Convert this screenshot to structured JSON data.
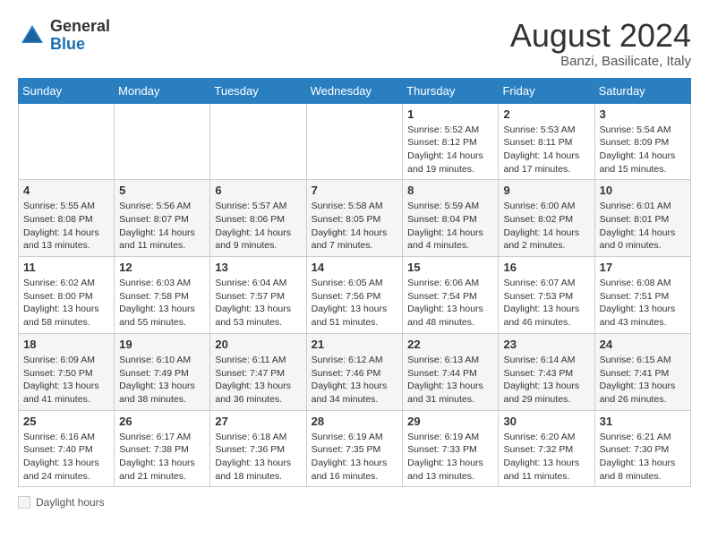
{
  "header": {
    "logo_general": "General",
    "logo_blue": "Blue",
    "month_year": "August 2024",
    "location": "Banzi, Basilicate, Italy"
  },
  "weekdays": [
    "Sunday",
    "Monday",
    "Tuesday",
    "Wednesday",
    "Thursday",
    "Friday",
    "Saturday"
  ],
  "weeks": [
    [
      {
        "day": "",
        "info": ""
      },
      {
        "day": "",
        "info": ""
      },
      {
        "day": "",
        "info": ""
      },
      {
        "day": "",
        "info": ""
      },
      {
        "day": "1",
        "info": "Sunrise: 5:52 AM\nSunset: 8:12 PM\nDaylight: 14 hours and 19 minutes."
      },
      {
        "day": "2",
        "info": "Sunrise: 5:53 AM\nSunset: 8:11 PM\nDaylight: 14 hours and 17 minutes."
      },
      {
        "day": "3",
        "info": "Sunrise: 5:54 AM\nSunset: 8:09 PM\nDaylight: 14 hours and 15 minutes."
      }
    ],
    [
      {
        "day": "4",
        "info": "Sunrise: 5:55 AM\nSunset: 8:08 PM\nDaylight: 14 hours and 13 minutes."
      },
      {
        "day": "5",
        "info": "Sunrise: 5:56 AM\nSunset: 8:07 PM\nDaylight: 14 hours and 11 minutes."
      },
      {
        "day": "6",
        "info": "Sunrise: 5:57 AM\nSunset: 8:06 PM\nDaylight: 14 hours and 9 minutes."
      },
      {
        "day": "7",
        "info": "Sunrise: 5:58 AM\nSunset: 8:05 PM\nDaylight: 14 hours and 7 minutes."
      },
      {
        "day": "8",
        "info": "Sunrise: 5:59 AM\nSunset: 8:04 PM\nDaylight: 14 hours and 4 minutes."
      },
      {
        "day": "9",
        "info": "Sunrise: 6:00 AM\nSunset: 8:02 PM\nDaylight: 14 hours and 2 minutes."
      },
      {
        "day": "10",
        "info": "Sunrise: 6:01 AM\nSunset: 8:01 PM\nDaylight: 14 hours and 0 minutes."
      }
    ],
    [
      {
        "day": "11",
        "info": "Sunrise: 6:02 AM\nSunset: 8:00 PM\nDaylight: 13 hours and 58 minutes."
      },
      {
        "day": "12",
        "info": "Sunrise: 6:03 AM\nSunset: 7:58 PM\nDaylight: 13 hours and 55 minutes."
      },
      {
        "day": "13",
        "info": "Sunrise: 6:04 AM\nSunset: 7:57 PM\nDaylight: 13 hours and 53 minutes."
      },
      {
        "day": "14",
        "info": "Sunrise: 6:05 AM\nSunset: 7:56 PM\nDaylight: 13 hours and 51 minutes."
      },
      {
        "day": "15",
        "info": "Sunrise: 6:06 AM\nSunset: 7:54 PM\nDaylight: 13 hours and 48 minutes."
      },
      {
        "day": "16",
        "info": "Sunrise: 6:07 AM\nSunset: 7:53 PM\nDaylight: 13 hours and 46 minutes."
      },
      {
        "day": "17",
        "info": "Sunrise: 6:08 AM\nSunset: 7:51 PM\nDaylight: 13 hours and 43 minutes."
      }
    ],
    [
      {
        "day": "18",
        "info": "Sunrise: 6:09 AM\nSunset: 7:50 PM\nDaylight: 13 hours and 41 minutes."
      },
      {
        "day": "19",
        "info": "Sunrise: 6:10 AM\nSunset: 7:49 PM\nDaylight: 13 hours and 38 minutes."
      },
      {
        "day": "20",
        "info": "Sunrise: 6:11 AM\nSunset: 7:47 PM\nDaylight: 13 hours and 36 minutes."
      },
      {
        "day": "21",
        "info": "Sunrise: 6:12 AM\nSunset: 7:46 PM\nDaylight: 13 hours and 34 minutes."
      },
      {
        "day": "22",
        "info": "Sunrise: 6:13 AM\nSunset: 7:44 PM\nDaylight: 13 hours and 31 minutes."
      },
      {
        "day": "23",
        "info": "Sunrise: 6:14 AM\nSunset: 7:43 PM\nDaylight: 13 hours and 29 minutes."
      },
      {
        "day": "24",
        "info": "Sunrise: 6:15 AM\nSunset: 7:41 PM\nDaylight: 13 hours and 26 minutes."
      }
    ],
    [
      {
        "day": "25",
        "info": "Sunrise: 6:16 AM\nSunset: 7:40 PM\nDaylight: 13 hours and 24 minutes."
      },
      {
        "day": "26",
        "info": "Sunrise: 6:17 AM\nSunset: 7:38 PM\nDaylight: 13 hours and 21 minutes."
      },
      {
        "day": "27",
        "info": "Sunrise: 6:18 AM\nSunset: 7:36 PM\nDaylight: 13 hours and 18 minutes."
      },
      {
        "day": "28",
        "info": "Sunrise: 6:19 AM\nSunset: 7:35 PM\nDaylight: 13 hours and 16 minutes."
      },
      {
        "day": "29",
        "info": "Sunrise: 6:19 AM\nSunset: 7:33 PM\nDaylight: 13 hours and 13 minutes."
      },
      {
        "day": "30",
        "info": "Sunrise: 6:20 AM\nSunset: 7:32 PM\nDaylight: 13 hours and 11 minutes."
      },
      {
        "day": "31",
        "info": "Sunrise: 6:21 AM\nSunset: 7:30 PM\nDaylight: 13 hours and 8 minutes."
      }
    ]
  ],
  "footer": {
    "daylight_label": "Daylight hours"
  }
}
